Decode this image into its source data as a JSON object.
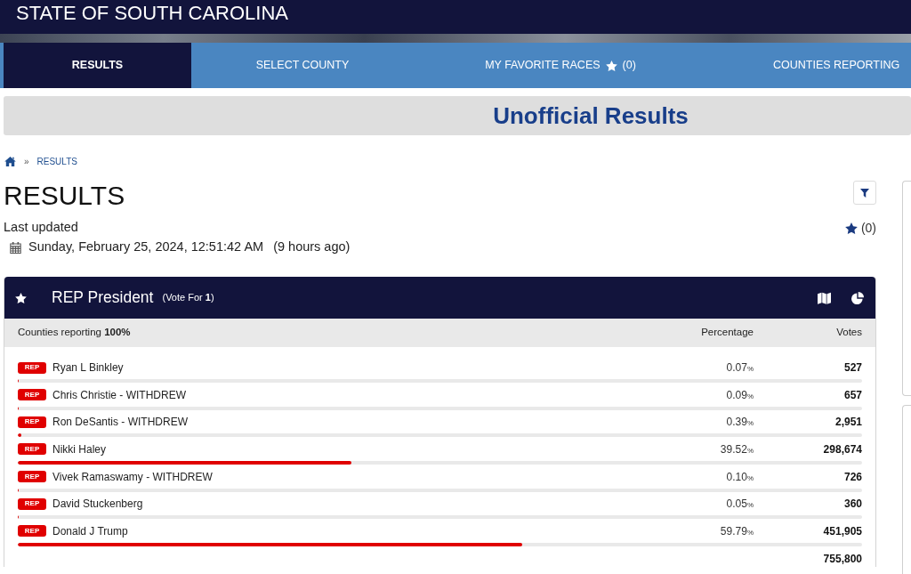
{
  "header": {
    "title": "STATE OF SOUTH CAROLINA"
  },
  "tabs": [
    {
      "kind": "plain",
      "label": "RESULTS",
      "selected": true
    },
    {
      "kind": "plain",
      "label": "SELECT COUNTY",
      "selected": false
    },
    {
      "kind": "favorites",
      "label": "MY FAVORITE RACES",
      "count": "(0)",
      "selected": false
    },
    {
      "kind": "plain",
      "label": "COUNTIES REPORTING",
      "selected": false
    }
  ],
  "banner": {
    "title": "Unofficial Results"
  },
  "breadcrumb": {
    "separator": "»",
    "items": [
      "RESULTS"
    ]
  },
  "page": {
    "title": "RESULTS",
    "last_updated_label": "Last updated",
    "timestamp": "Sunday, February 25, 2024, 12:51:42 AM",
    "relative_time": "(9 hours ago)",
    "favorites_count": "(0)"
  },
  "race": {
    "title": "REP President",
    "vote_for": "(Vote For **1**)",
    "reporting": "Counties reporting **100%**",
    "columns": [
      "Percentage",
      "Votes"
    ],
    "candidates": [
      {
        "party": "REP",
        "name": "Ryan L Binkley",
        "percentage": "0.07",
        "unit": "%",
        "votes": "527",
        "level": 0.0007
      },
      {
        "party": "REP",
        "name": "Chris Christie - WITHDREW",
        "percentage": "0.09",
        "unit": "%",
        "votes": "657",
        "level": 0.0009
      },
      {
        "party": "REP",
        "name": "Ron DeSantis - WITHDREW",
        "percentage": "0.39",
        "unit": "%",
        "votes": "2,951",
        "level": 0.0039
      },
      {
        "party": "REP",
        "name": "Nikki Haley",
        "percentage": "39.52",
        "unit": "%",
        "votes": "298,674",
        "level": 0.3952
      },
      {
        "party": "REP",
        "name": "Vivek Ramaswamy - WITHDREW",
        "percentage": "0.10",
        "unit": "%",
        "votes": "726",
        "level": 0.001
      },
      {
        "party": "REP",
        "name": "David Stuckenberg",
        "percentage": "0.05",
        "unit": "%",
        "votes": "360",
        "level": 0.0005
      },
      {
        "party": "REP",
        "name": "Donald J Trump",
        "percentage": "59.79",
        "unit": "%",
        "votes": "451,905",
        "level": 0.5979
      }
    ],
    "total_votes": "755,800"
  }
}
